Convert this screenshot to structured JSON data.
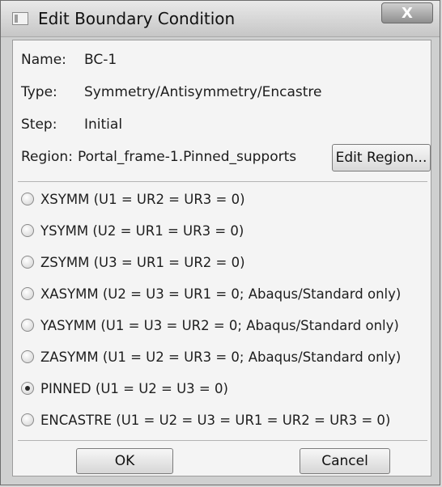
{
  "window": {
    "title": "Edit Boundary Condition",
    "close_glyph": "X"
  },
  "info": {
    "name_label": "Name:",
    "name_value": "BC-1",
    "type_label": "Type:",
    "type_value": "Symmetry/Antisymmetry/Encastre",
    "step_label": "Step:",
    "step_value": "Initial",
    "region_label": "Region:",
    "region_value": "Portal_frame-1.Pinned_supports",
    "edit_region_label": "Edit Region..."
  },
  "options": [
    {
      "label": "XSYMM (U1 = UR2 = UR3 = 0)",
      "checked": false
    },
    {
      "label": "YSYMM (U2 = UR1 = UR3 = 0)",
      "checked": false
    },
    {
      "label": "ZSYMM (U3 = UR1 = UR2 = 0)",
      "checked": false
    },
    {
      "label": "XASYMM (U2 = U3 = UR1 = 0; Abaqus/Standard only)",
      "checked": false
    },
    {
      "label": "YASYMM (U1 = U3 = UR2 = 0; Abaqus/Standard only)",
      "checked": false
    },
    {
      "label": "ZASYMM (U1 = U2 = UR3 = 0; Abaqus/Standard only)",
      "checked": false
    },
    {
      "label": "PINNED (U1 = U2 = U3 = 0)",
      "checked": true
    },
    {
      "label": "ENCASTRE (U1 = U2 = U3 = UR1 = UR2 = UR3 = 0)",
      "checked": false
    }
  ],
  "buttons": {
    "ok_label": "OK",
    "cancel_label": "Cancel"
  }
}
